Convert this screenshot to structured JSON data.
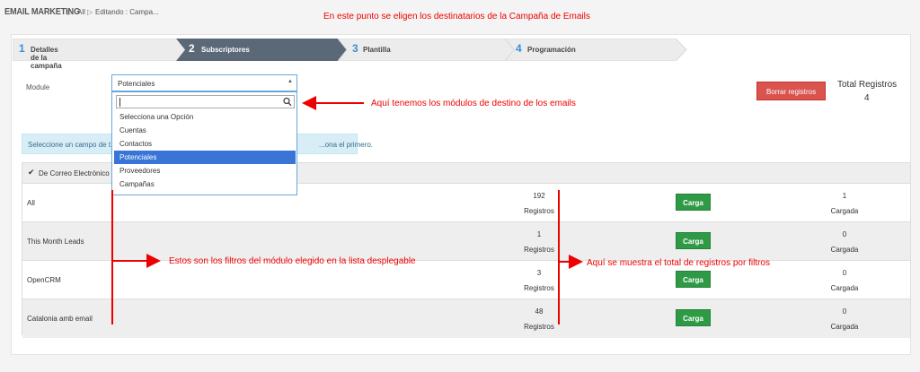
{
  "header": {
    "brand": "EMAIL MARKETING",
    "crumbs": [
      "All",
      "Editando : Campa..."
    ]
  },
  "annotations": {
    "top": "En este punto se eligen los destinatarios de la Campaña de Emails",
    "modules": "Aquí tenemos los módulos de destino de los emails",
    "filters": "Estos son los filtros del módulo elegido en la lista desplegable",
    "totals": "Aquí se muestra el total de registros por filtros"
  },
  "steps": [
    {
      "num": "1",
      "label": "Detalles de la campaña"
    },
    {
      "num": "2",
      "label": "Subscriptores"
    },
    {
      "num": "3",
      "label": "Plantilla"
    },
    {
      "num": "4",
      "label": "Programación"
    }
  ],
  "module": {
    "label": "Module",
    "selected": "Potenciales",
    "options": [
      "Selecciona una Opción",
      "Cuentas",
      "Contactos",
      "Potenciales",
      "Proveedores",
      "Campañas"
    ]
  },
  "actions": {
    "borrar": "Borrar registros",
    "total_label": "Total Registros",
    "total_value": "4"
  },
  "info": {
    "left": "Seleccione un campo de t...",
    "right": "...ona el primero."
  },
  "table": {
    "header": "De Correo Electrónico",
    "rows": [
      {
        "name": "All",
        "count": "192",
        "unit": "Registros",
        "action": "Carga",
        "loaded": "1",
        "loaded_label": "Cargada"
      },
      {
        "name": "This Month Leads",
        "count": "1",
        "unit": "Registros",
        "action": "Carga",
        "loaded": "0",
        "loaded_label": "Cargada"
      },
      {
        "name": "OpenCRM",
        "count": "3",
        "unit": "Registros",
        "action": "Carga",
        "loaded": "0",
        "loaded_label": "Cargada"
      },
      {
        "name": "Catalonia amb email",
        "count": "48",
        "unit": "Registros",
        "action": "Carga",
        "loaded": "0",
        "loaded_label": "Cargada"
      }
    ]
  },
  "colors": {
    "accent_red": "#e00000",
    "active_step": "#5b6878",
    "carga_green": "#2f9a46",
    "borrar_red": "#d9534f",
    "selected_option": "#3875d7"
  }
}
